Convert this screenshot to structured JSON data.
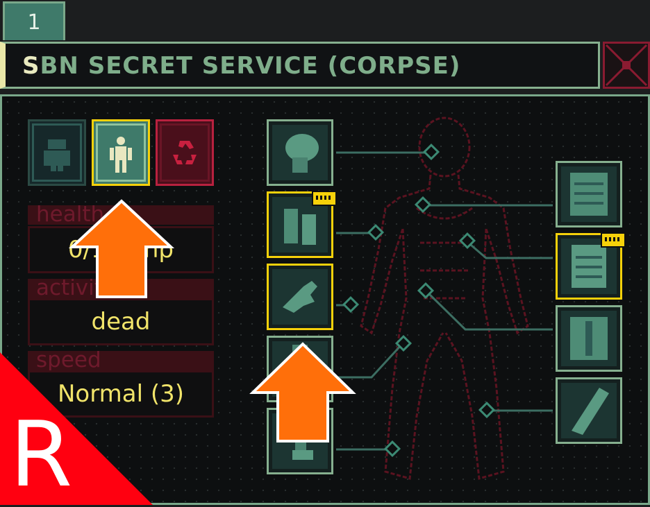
{
  "tab": {
    "label": "1"
  },
  "title": {
    "first_letter": "S",
    "rest": "BN SECRET SERVICE (CORPSE)"
  },
  "stats": [
    {
      "label": "health",
      "value": "0/100 hp"
    },
    {
      "label": "activity",
      "value": "dead"
    },
    {
      "label": "speed",
      "value": "Normal (3)"
    }
  ],
  "mode_buttons": [
    "armor-icon",
    "body-icon",
    "recycle-icon"
  ],
  "limb_slots_left": [
    "head",
    "arm",
    "hand",
    "leg",
    "foot"
  ],
  "limb_slots_right": [
    "chest",
    "torso",
    "abdomen",
    "leg"
  ],
  "overlays": {
    "corner_letter": "R"
  },
  "colors": {
    "accent": "#f6d10a",
    "frame": "#86b08f",
    "danger": "#b8213f",
    "value_text": "#f1e46a",
    "arrow": "#ff6f0a"
  }
}
